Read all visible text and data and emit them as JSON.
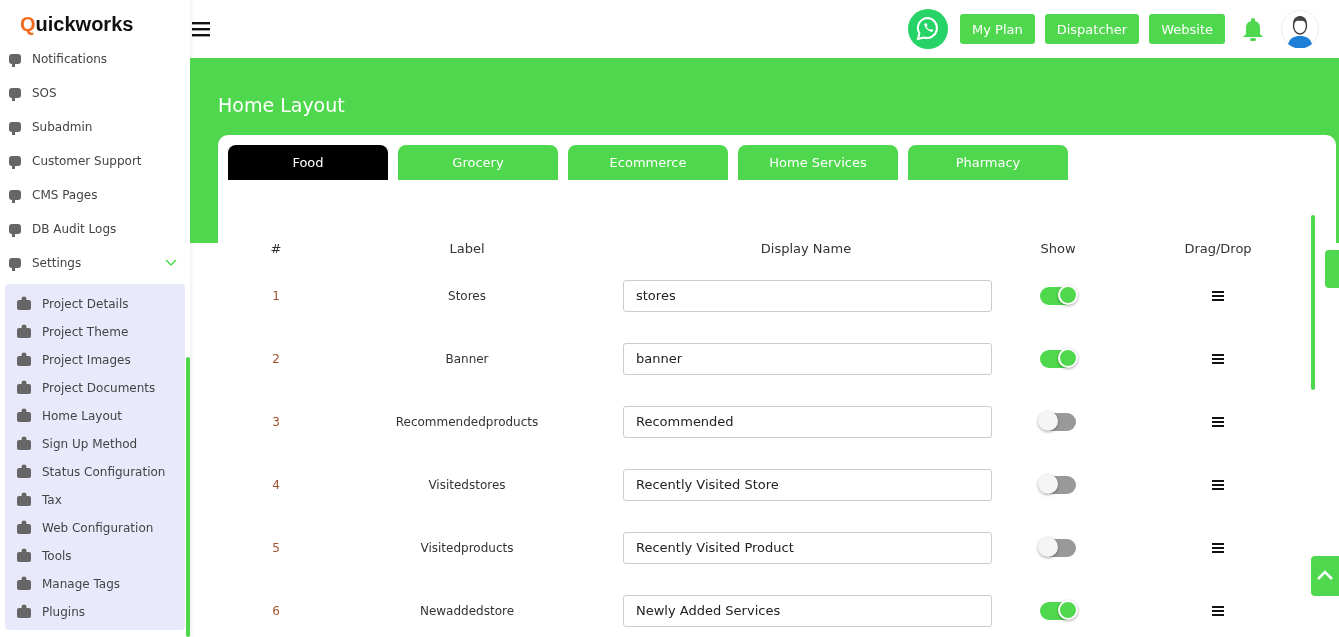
{
  "sidebar": {
    "logo": "Quickworks",
    "items": [
      {
        "label": "Notifications"
      },
      {
        "label": "SOS"
      },
      {
        "label": "Subadmin"
      },
      {
        "label": "Customer Support"
      },
      {
        "label": "CMS Pages"
      },
      {
        "label": "DB Audit Logs"
      },
      {
        "label": "Settings",
        "expanded": true,
        "children": [
          {
            "label": "Project Details"
          },
          {
            "label": "Project Theme"
          },
          {
            "label": "Project Images"
          },
          {
            "label": "Project Documents"
          },
          {
            "label": "Home Layout"
          },
          {
            "label": "Sign Up Method"
          },
          {
            "label": "Status Configuration"
          },
          {
            "label": "Tax"
          },
          {
            "label": "Web Configuration"
          },
          {
            "label": "Tools"
          },
          {
            "label": "Manage Tags"
          },
          {
            "label": "Plugins"
          }
        ]
      }
    ]
  },
  "header": {
    "buttons": [
      "My Plan",
      "Dispatcher",
      "Website"
    ]
  },
  "page": {
    "title": "Home Layout"
  },
  "tabs": [
    {
      "label": "Food",
      "selected": true
    },
    {
      "label": "Grocery",
      "selected": false
    },
    {
      "label": "Ecommerce",
      "selected": false
    },
    {
      "label": "Home Services",
      "selected": false
    },
    {
      "label": "Pharmacy",
      "selected": false
    }
  ],
  "table": {
    "columns": [
      "#",
      "Label",
      "Display Name",
      "Show",
      "Drag/Drop"
    ],
    "rows": [
      {
        "number": "1",
        "label": "Stores",
        "display_name": "stores",
        "show": true
      },
      {
        "number": "2",
        "label": "Banner",
        "display_name": "banner",
        "show": true
      },
      {
        "number": "3",
        "label": "Recommendedproducts",
        "display_name": "Recommended",
        "show": false
      },
      {
        "number": "4",
        "label": "Visitedstores",
        "display_name": "Recently Visited Store",
        "show": false
      },
      {
        "number": "5",
        "label": "Visitedproducts",
        "display_name": "Recently Visited Product",
        "show": false
      },
      {
        "number": "6",
        "label": "Newaddedstore",
        "display_name": "Newly Added Services",
        "show": true
      }
    ]
  }
}
